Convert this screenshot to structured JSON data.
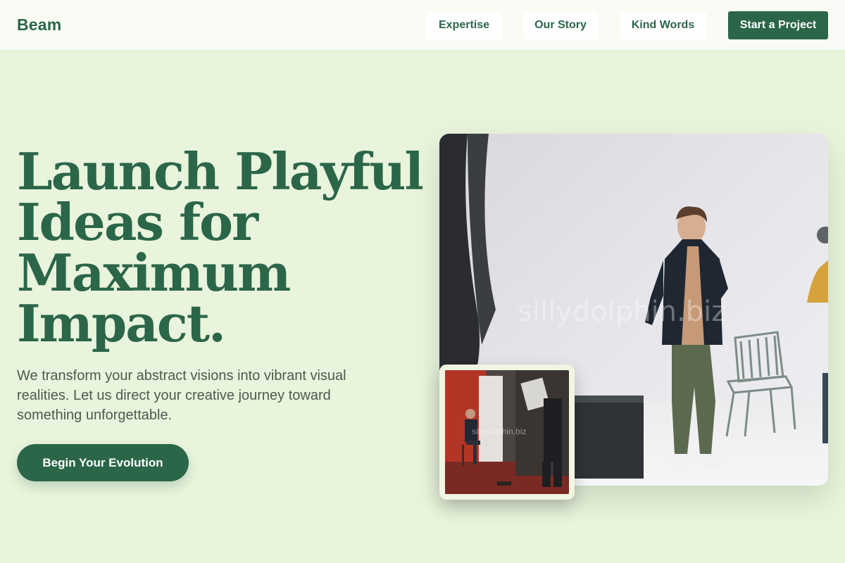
{
  "header": {
    "brand": "Beam",
    "nav": [
      "Expertise",
      "Our Story",
      "Kind Words"
    ],
    "cta_label": "Start a Project"
  },
  "hero": {
    "headline_lines": [
      "Launch Playful",
      "Ideas for",
      "Maximum",
      "Impact."
    ],
    "subtext": "We transform your abstract visions into vibrant visual realities. Let us direct your creative journey toward something unforgettable.",
    "button_label": "Begin Your Evolution"
  },
  "images": {
    "main_watermark": "sillydolphin.biz",
    "inset_watermark": "sillydolphin.biz"
  },
  "colors": {
    "brand_green": "#2b6649",
    "page_background": "#e9f4dc",
    "header_background": "#f9fcf5"
  }
}
